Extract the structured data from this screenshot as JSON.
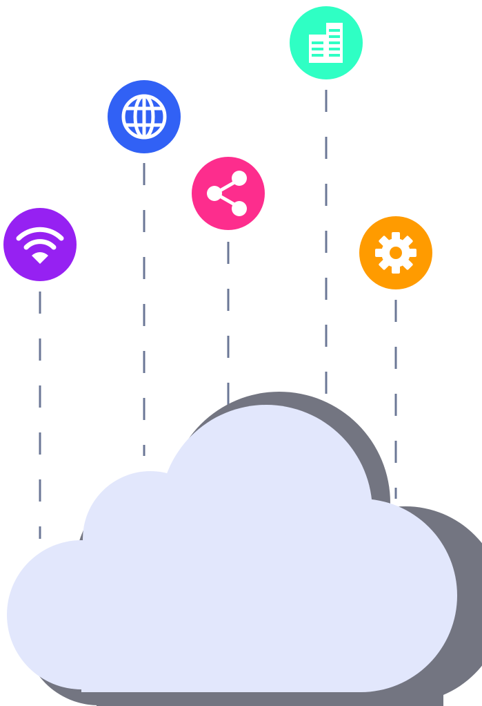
{
  "colors": {
    "background": "#ffffff",
    "cloud_fill": "#e2e7fc",
    "cloud_shadow": "#737581",
    "connector_line": "#6b7796",
    "icon_glyph": "#ffffff"
  },
  "icons": [
    {
      "name": "wifi-icon",
      "color": "#9621f2"
    },
    {
      "name": "globe-icon",
      "color": "#3161f5"
    },
    {
      "name": "share-icon",
      "color": "#fd2d8d"
    },
    {
      "name": "building-icon",
      "color": "#2fffc4"
    },
    {
      "name": "gear-icon",
      "color": "#ff9b00"
    }
  ]
}
